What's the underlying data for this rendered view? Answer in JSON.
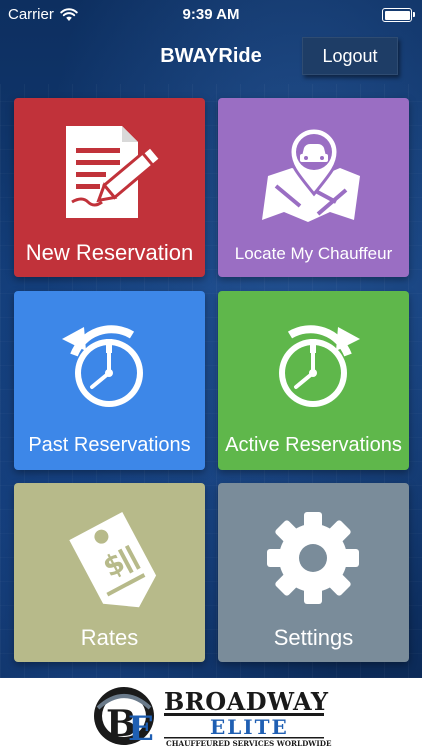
{
  "status_bar": {
    "carrier": "Carrier",
    "time": "9:39 AM"
  },
  "nav": {
    "title": "BWAYRide",
    "logout_label": "Logout"
  },
  "tiles": [
    {
      "label": "New Reservation",
      "icon": "new-reservation-icon",
      "color": "#c1323a"
    },
    {
      "label": "Locate My Chauffeur",
      "icon": "map-pin-car-icon",
      "color": "#9a6ec3"
    },
    {
      "label": "Past Reservations",
      "icon": "clock-back-arrow-icon",
      "color": "#3d87e8"
    },
    {
      "label": "Active Reservations",
      "icon": "clock-forward-arrow-icon",
      "color": "#5fb74b"
    },
    {
      "label": "Rates",
      "icon": "price-tag-icon",
      "color": "#b7ba8a"
    },
    {
      "label": "Settings",
      "icon": "gear-icon",
      "color": "#7a8c9a"
    }
  ],
  "footer": {
    "logo": {
      "initials": "BE",
      "name_top": "BROADWAY",
      "name_bottom": "ELITE",
      "tagline": "CHAUFFEURED SERVICES WORLDWIDE"
    }
  }
}
